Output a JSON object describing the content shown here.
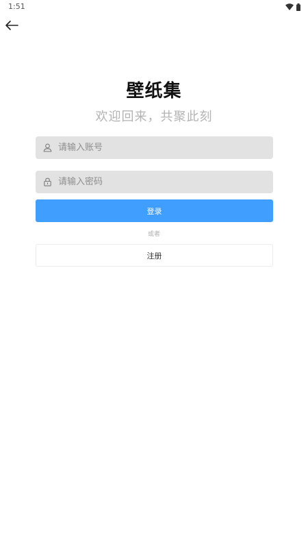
{
  "status_bar": {
    "time": "1:51",
    "icons": [
      "wifi-icon",
      "battery-icon"
    ]
  },
  "nav": {
    "back_icon": "arrow-left-icon"
  },
  "header": {
    "title": "壁纸集",
    "subtitle": "欢迎回来，共聚此刻"
  },
  "form": {
    "account": {
      "icon": "user-icon",
      "placeholder": "请输入账号",
      "value": ""
    },
    "password": {
      "icon": "lock-icon",
      "placeholder": "请输入密码",
      "value": ""
    },
    "login_label": "登录",
    "or_label": "或者",
    "register_label": "注册"
  },
  "colors": {
    "primary": "#409eff",
    "input_bg": "#e2e2e2",
    "subtitle": "#b3b3b3"
  }
}
